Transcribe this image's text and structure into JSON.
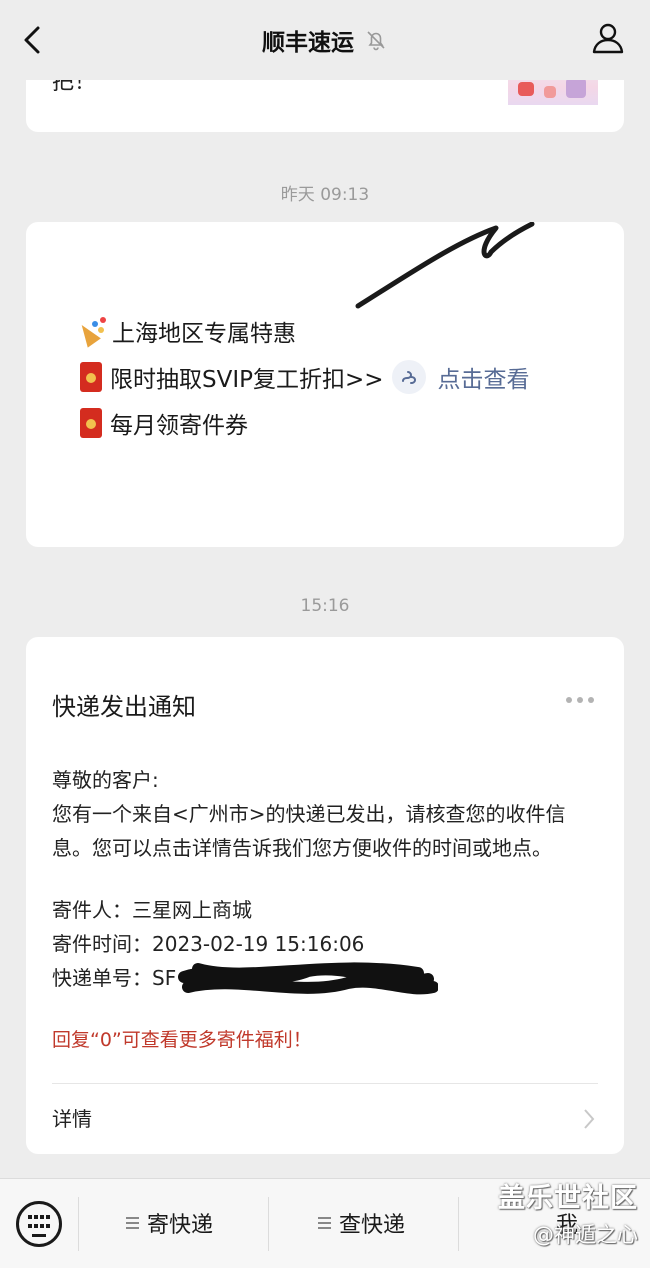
{
  "header": {
    "title": "顺丰速运",
    "icons": {
      "back": "chevron-left-icon",
      "mute": "bell-off-icon",
      "profile": "user-icon"
    }
  },
  "previous_card": {
    "cut_text": "把！"
  },
  "messages": [
    {
      "timestamp": "昨天 09:13",
      "promo": {
        "line1": "上海地区专属特惠",
        "line2": "限时抽取SVIP复工折扣>>",
        "line2_link": "点击查看",
        "line3": "每月领寄件券"
      }
    },
    {
      "timestamp": "15:16",
      "notify": {
        "title": "快递发出通知",
        "greeting": "尊敬的客户:",
        "body_line1": "您有一个来自<广州市>的快递已发出，请核查您的收件信",
        "body_line2": "息。您可以点击详情告诉我们您方便收件的时间或地点。",
        "sender": "寄件人：三星网上商城",
        "send_time": "寄件时间：2023-02-19 15:16:06",
        "tracking": "快递单号：SF",
        "reply_hint": "回复“0”可查看更多寄件福利！",
        "details_label": "详情"
      }
    }
  ],
  "bottom_menu": {
    "items": [
      "寄快递",
      "查快递",
      "我"
    ]
  },
  "watermark": {
    "line1": "盖乐世社区",
    "line2": "@神遁之心"
  },
  "colors": {
    "link": "#576b95",
    "red_text": "#c0392b",
    "background": "#ededed"
  }
}
